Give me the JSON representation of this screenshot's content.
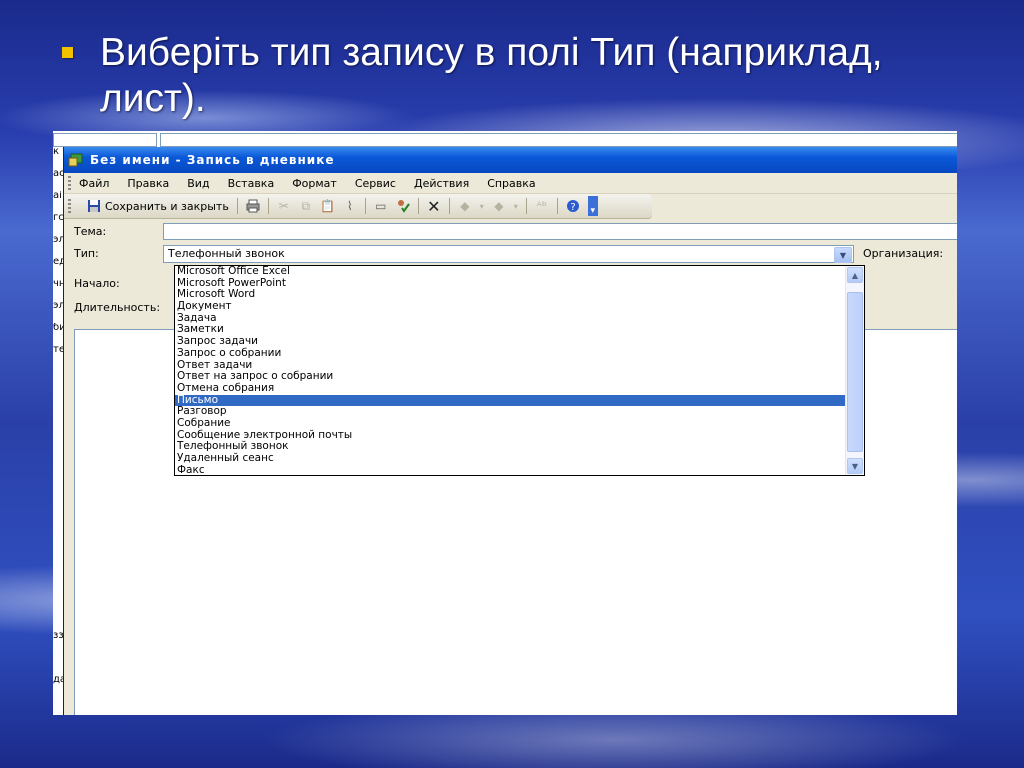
{
  "slide": {
    "bullet_text": "Виберіть тип запису в полі Тип (наприклад, лист)."
  },
  "window": {
    "title": "Без имени - Запись в дневнике"
  },
  "menu": [
    "Файл",
    "Правка",
    "Вид",
    "Вставка",
    "Формат",
    "Сервис",
    "Действия",
    "Справка"
  ],
  "toolbar": {
    "save_close_label": "Сохранить и закрыть"
  },
  "form": {
    "subject_label": "Тема:",
    "type_label": "Тип:",
    "type_value": "Телефонный звонок",
    "org_label": "Организация:",
    "start_label": "Начало:",
    "duration_label": "Длительность:"
  },
  "dropdown": {
    "items": [
      "Microsoft Office Excel",
      "Microsoft PowerPoint",
      "Microsoft Word",
      "Документ",
      "Задача",
      "Заметки",
      "Запрос задачи",
      "Запрос о собрании",
      "Ответ задачи",
      "Ответ на запрос о собрании",
      "Отмена собрания",
      "Письмо",
      "Разговор",
      "Собрание",
      "Сообщение электронной почты",
      "Телефонный звонок",
      "Удаленный сеанс",
      "Факс"
    ],
    "selected": "Письмо"
  },
  "background_window": {
    "edge_chars": [
      "к",
      "ас",
      "аі",
      "гс",
      "эл",
      "ед",
      "чн",
      "эл",
      "би",
      "те",
      "",
      "",
      "",
      "",
      "",
      "",
      "",
      "",
      "",
      "",
      "",
      "",
      "зз",
      "",
      "да",
      ""
    ]
  },
  "colors": {
    "selection": "#316ac5",
    "titlebar": "#0a58d8",
    "bullet": "#f2c200"
  }
}
